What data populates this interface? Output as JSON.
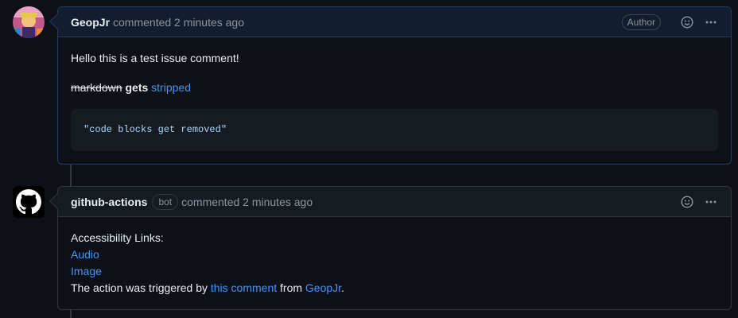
{
  "comments": [
    {
      "username": "GeopJr",
      "meta": "commented 2 minutes ago",
      "badge": "Author",
      "body": {
        "line1": "Hello this is a test issue comment!",
        "strike": "markdown",
        "bold": "gets",
        "link": "stripped",
        "code": "\"code blocks get removed\""
      }
    },
    {
      "username": "github-actions",
      "bot_label": "bot",
      "meta": "commented 2 minutes ago",
      "body": {
        "heading": "Accessibility Links:",
        "link_audio": "Audio",
        "link_image": "Image",
        "trigger_prefix": "The action was triggered by",
        "trigger_link": "this comment",
        "from_text": "from",
        "user_link": "GeopJr",
        "period": "."
      }
    }
  ],
  "icons": [
    "smiley-icon",
    "kebab-horizontal-icon",
    "github-mark-icon"
  ],
  "colors": {
    "link": "#4493f8",
    "background": "#0d1117",
    "author_border": "#1f3a63"
  }
}
